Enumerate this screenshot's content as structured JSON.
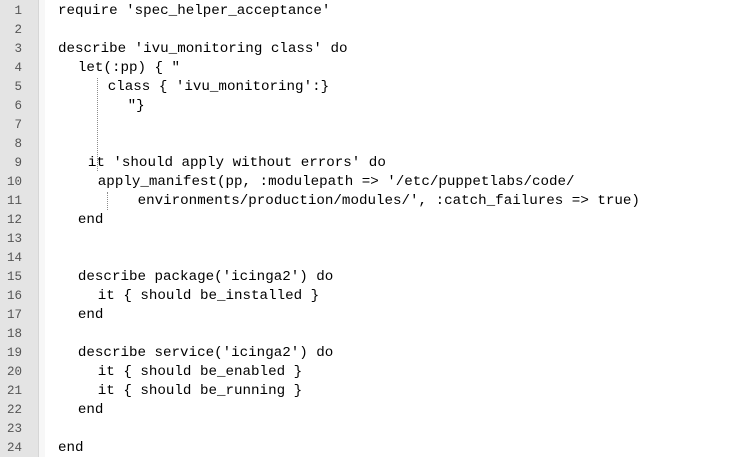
{
  "editor": {
    "lines": [
      {
        "number": "1",
        "indent": 0,
        "text": "require 'spec_helper_acceptance'"
      },
      {
        "number": "2",
        "indent": 0,
        "text": ""
      },
      {
        "number": "3",
        "indent": 0,
        "text": "describe 'ivu_monitoring class' do"
      },
      {
        "number": "4",
        "indent": 2,
        "text": "let(:pp) { \""
      },
      {
        "number": "5",
        "indent": 5,
        "text": "class { 'ivu_monitoring':}"
      },
      {
        "number": "6",
        "indent": 7,
        "text": "\"}"
      },
      {
        "number": "7",
        "indent": 0,
        "text": ""
      },
      {
        "number": "8",
        "indent": 0,
        "text": ""
      },
      {
        "number": "9",
        "indent": 3,
        "text": "it 'should apply without errors' do"
      },
      {
        "number": "10",
        "indent": 4,
        "text": "apply_manifest(pp, :modulepath => '/etc/puppetlabs/code/"
      },
      {
        "number": "11",
        "indent": 8,
        "text": "environments/production/modules/', :catch_failures => true)"
      },
      {
        "number": "12",
        "indent": 2,
        "text": "end"
      },
      {
        "number": "13",
        "indent": 0,
        "text": ""
      },
      {
        "number": "14",
        "indent": 0,
        "text": ""
      },
      {
        "number": "15",
        "indent": 2,
        "text": "describe package('icinga2') do"
      },
      {
        "number": "16",
        "indent": 4,
        "text": "it { should be_installed }"
      },
      {
        "number": "17",
        "indent": 2,
        "text": "end"
      },
      {
        "number": "18",
        "indent": 0,
        "text": ""
      },
      {
        "number": "19",
        "indent": 2,
        "text": "describe service('icinga2') do"
      },
      {
        "number": "20",
        "indent": 4,
        "text": "it { should be_enabled }"
      },
      {
        "number": "21",
        "indent": 4,
        "text": "it { should be_running }"
      },
      {
        "number": "22",
        "indent": 2,
        "text": "end"
      },
      {
        "number": "23",
        "indent": 0,
        "text": ""
      },
      {
        "number": "24",
        "indent": 0,
        "text": "end"
      }
    ]
  }
}
